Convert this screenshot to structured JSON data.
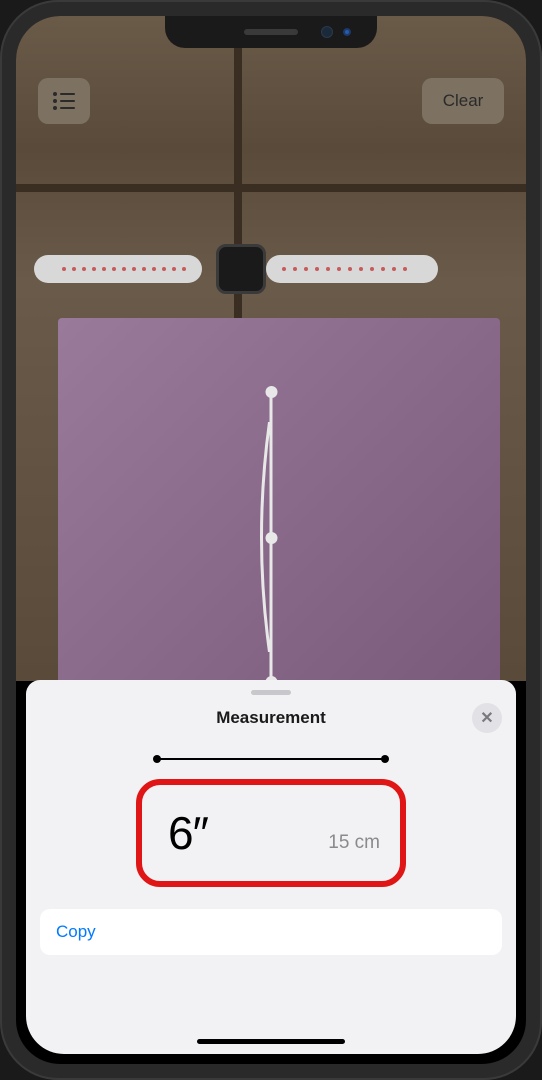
{
  "toolbar": {
    "clear_label": "Clear"
  },
  "sheet": {
    "title": "Measurement",
    "close_glyph": "✕",
    "primary_value": "6″",
    "secondary_value": "15 cm",
    "copy_label": "Copy"
  },
  "annotation": {
    "highlight_color": "#e01515"
  }
}
